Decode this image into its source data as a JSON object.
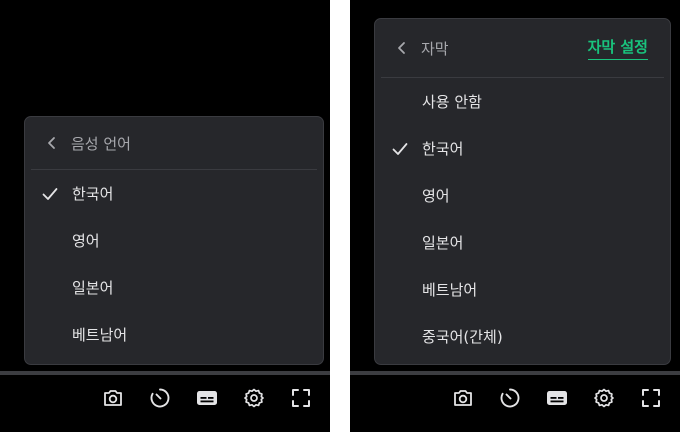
{
  "audio_menu": {
    "title": "음성 언어",
    "items": [
      {
        "label": "한국어",
        "selected": true
      },
      {
        "label": "영어",
        "selected": false
      },
      {
        "label": "일본어",
        "selected": false
      },
      {
        "label": "베트남어",
        "selected": false
      }
    ]
  },
  "subtitle_menu": {
    "title": "자막",
    "settings_link": "자막 설정",
    "items": [
      {
        "label": "사용 안함",
        "selected": false
      },
      {
        "label": "한국어",
        "selected": true
      },
      {
        "label": "영어",
        "selected": false
      },
      {
        "label": "일본어",
        "selected": false
      },
      {
        "label": "베트남어",
        "selected": false
      },
      {
        "label": "중국어(간체)",
        "selected": false
      }
    ]
  },
  "controls": [
    "camera-icon",
    "speed-timer-icon",
    "subtitles-icon",
    "gear-icon",
    "fullscreen-icon"
  ],
  "colors": {
    "menu_bg": "#26272b",
    "accent": "#19c37d",
    "text": "#e4e4e6",
    "muted": "#a7a8ad"
  }
}
